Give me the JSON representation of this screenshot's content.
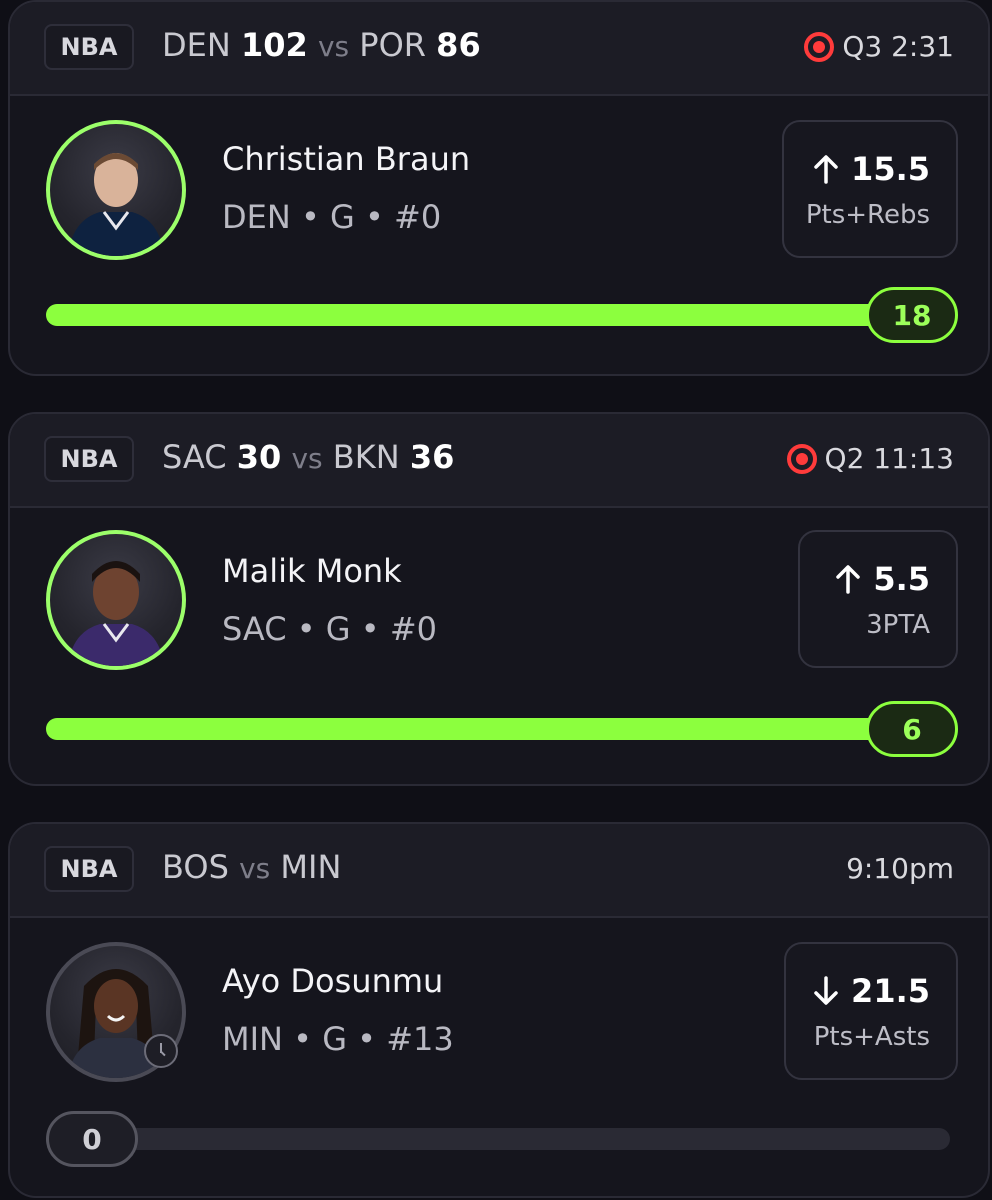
{
  "cards": [
    {
      "league": "NBA",
      "team1": "DEN",
      "score1": "102",
      "vs": "vs",
      "team2": "POR",
      "score2": "86",
      "status": "Q3 2:31",
      "status_icon": "live-icon",
      "player": {
        "name": "Christian Braun",
        "meta": "DEN • G • #0"
      },
      "line": {
        "direction": "up",
        "value": "15.5",
        "stat": "Pts+Rebs"
      },
      "progress": {
        "current": "18",
        "fraction": 1.0
      }
    },
    {
      "league": "NBA",
      "team1": "SAC",
      "score1": "30",
      "vs": "vs",
      "team2": "BKN",
      "score2": "36",
      "status": "Q2 11:13",
      "status_icon": "live-icon",
      "player": {
        "name": "Malik Monk",
        "meta": "SAC • G • #0"
      },
      "line": {
        "direction": "up",
        "value": "5.5",
        "stat": "3PTA"
      },
      "progress": {
        "current": "6",
        "fraction": 1.0
      }
    },
    {
      "league": "NBA",
      "team1": "BOS",
      "score1": "",
      "vs": "vs",
      "team2": "MIN",
      "score2": "",
      "status": "9:10pm",
      "status_icon": "clock-icon",
      "player": {
        "name": "Ayo Dosunmu",
        "meta": "MIN • G • #13"
      },
      "line": {
        "direction": "down",
        "value": "21.5",
        "stat": "Pts+Asts"
      },
      "progress": {
        "current": "0",
        "fraction": 0.0
      }
    }
  ],
  "colors": {
    "accent": "#8cff3e",
    "live": "#ff3b3b",
    "background": "#0f0f16",
    "card": "#15151d"
  }
}
